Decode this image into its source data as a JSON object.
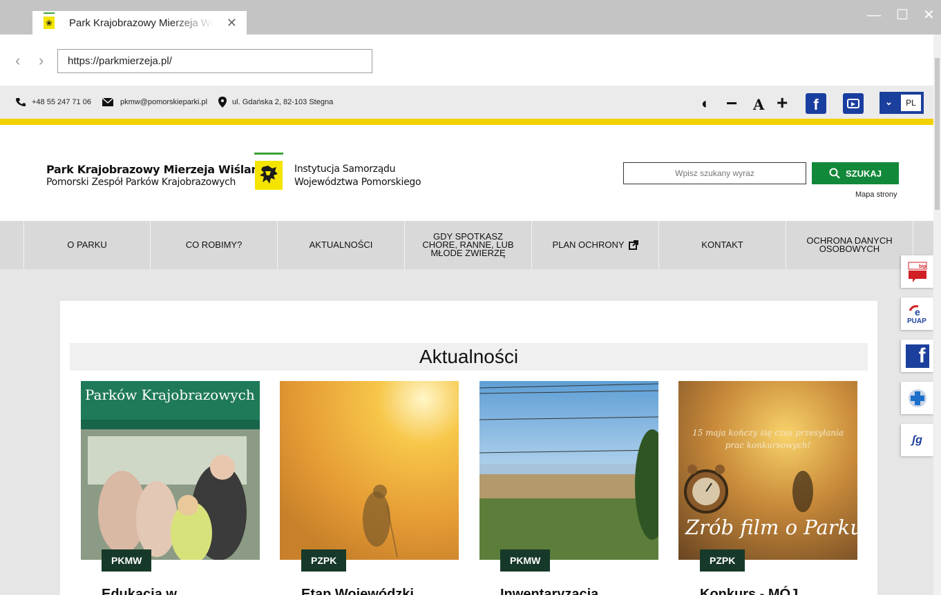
{
  "browser": {
    "tab_title": "Park Krajobrazowy Mierzeja Wiślana",
    "close_glyph": "✕",
    "url": "https://parkmierzeja.pl/",
    "back_glyph": "‹",
    "forward_glyph": "›",
    "minimize_glyph": "—",
    "maximize_glyph": "☐",
    "window_close_glyph": "✕"
  },
  "topbar": {
    "phone": "+48 55 247 71 06",
    "email": "pkmw@pomorskieparki.pl",
    "address": "ul. Gdańska 2, 82-103 Stegna",
    "contrast_glyph": "◐",
    "font_minus": "−",
    "font_label": "A",
    "font_plus": "+",
    "facebook_glyph": "f",
    "language": "PL",
    "language_chevron": "⌄"
  },
  "header": {
    "org_name": "Park Krajobrazowy Mierzeja Wiślana",
    "org_sub": "Pomorski Zespół Parków Krajobrazowych",
    "institution_line1": "Instytucja Samorządu",
    "institution_line2": "Województwa Pomorskiego",
    "search_placeholder": "Wpisz szukany wyraz",
    "search_button": "SZUKAJ",
    "sitemap": "Mapa strony"
  },
  "nav": [
    {
      "label": "O PARKU"
    },
    {
      "label": "CO ROBIMY?"
    },
    {
      "label": "AKTUALNOŚCI"
    },
    {
      "label": "GDY SPOTKASZ\nCHORE, RANNE, LUB\nMŁODE ZWIERZĘ"
    },
    {
      "label": "PLAN OCHRONY"
    },
    {
      "label": "KONTAKT"
    },
    {
      "label": "OCHRONA DANYCH\nOSOBOWYCH"
    }
  ],
  "news": {
    "title": "Aktualności",
    "cards": [
      {
        "tag": "PKMW",
        "title": "Edukacja w",
        "image_text": "Parków Krajobrazowych"
      },
      {
        "tag": "PZPK",
        "title": "Etap Wojewódzki"
      },
      {
        "tag": "PKMW",
        "title": "Inwentaryzacja"
      },
      {
        "tag": "PZPK",
        "title": "Konkurs - MÓJ",
        "image_text_top": "15 maja kończy się czas przesyłania prac konkursowych!",
        "image_text_bottom": "Zrób film o Parku"
      }
    ]
  },
  "sidebar": {
    "bip_label": "bip",
    "epuap_label": "PUAP",
    "epuap_e": "e",
    "facebook_glyph": "f",
    "sign_label": "ʃg"
  },
  "colors": {
    "accent_yellow": "#f2d100",
    "search_green": "#12893a",
    "tag_green": "#17392a",
    "brand_blue": "#1b3f9c"
  }
}
